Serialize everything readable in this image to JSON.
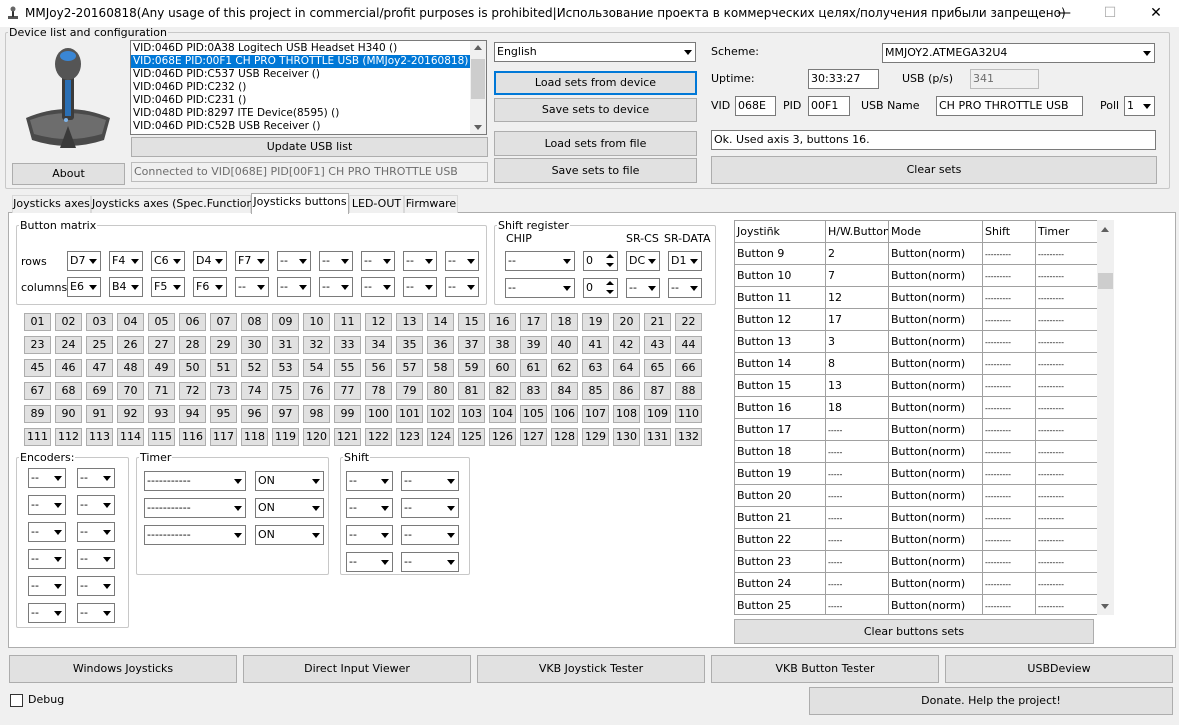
{
  "window": {
    "title": "MMJoy2-20160818(Any usage of this project in commercial/profit purposes is prohibited|Использование проекта в коммерческих целях/получения прибыли запрещено)",
    "min": "—",
    "max": "☐",
    "close": "✕"
  },
  "device_group": {
    "legend": "Device list and configuration",
    "about": "About",
    "update": "Update USB list",
    "status": "Connected to VID[068E] PID[00F1] CH PRO THROTTLE USB",
    "devices": [
      "VID:046D PID:0A38 Logitech USB Headset H340 ()",
      "VID:068E PID:00F1 CH PRO THROTTLE USB (MMJoy2-20160818)",
      "VID:046D PID:C537 USB Receiver ()",
      "VID:046D PID:C232  ()",
      "VID:046D PID:C231  ()",
      "VID:048D PID:8297 ITE Device(8595) ()",
      "VID:046D PID:C52B USB Receiver ()"
    ]
  },
  "language": "English",
  "sets": {
    "load_device": "Load sets from device",
    "save_device": "Save sets to device",
    "load_file": "Load sets from file",
    "save_file": "Save sets to file"
  },
  "config": {
    "scheme_label": "Scheme:",
    "scheme": "MMJOY2.ATMEGA32U4",
    "uptime_label": "Uptime:",
    "uptime": "30:33:27",
    "usb_label": "USB (p/s)",
    "usb": "341",
    "vid_label": "VID",
    "vid": "068E",
    "pid_label": "PID",
    "pid": "00F1",
    "name_label": "USB Name",
    "name": "CH PRO THROTTLE USB",
    "poll_label": "Poll",
    "poll": "1",
    "message": "Ok. Used axis  3, buttons 16.",
    "clear_sets": "Clear sets"
  },
  "tabs": [
    "Joysticks axes",
    "Joysticks axes (Spec.Functions)",
    "Joysticks buttons",
    "LED-OUT",
    "Firmware"
  ],
  "matrix": {
    "legend": "Button matrix",
    "rows_label": "rows",
    "cols_label": "columns",
    "rows": [
      "D7",
      "F4",
      "C6",
      "D4",
      "F7",
      "--",
      "--",
      "--",
      "--",
      "--"
    ],
    "cols": [
      "E6",
      "B4",
      "F5",
      "F6",
      "--",
      "--",
      "--",
      "--",
      "--",
      "--"
    ]
  },
  "shift_reg": {
    "legend": "Shift register",
    "chip": "CHIP",
    "srcs": "SR-CS",
    "srdata": "SR-DATA",
    "row1": [
      "--",
      "0",
      "DC",
      "D1"
    ],
    "row2": [
      "--",
      "0",
      "--",
      "--"
    ]
  },
  "buttons": [
    "01",
    "02",
    "03",
    "04",
    "05",
    "06",
    "07",
    "08",
    "09",
    "10",
    "11",
    "12",
    "13",
    "14",
    "15",
    "16",
    "17",
    "18",
    "19",
    "20",
    "21",
    "22",
    "23",
    "24",
    "25",
    "26",
    "27",
    "28",
    "29",
    "30",
    "31",
    "32",
    "33",
    "34",
    "35",
    "36",
    "37",
    "38",
    "39",
    "40",
    "41",
    "42",
    "43",
    "44",
    "45",
    "46",
    "47",
    "48",
    "49",
    "50",
    "51",
    "52",
    "53",
    "54",
    "55",
    "56",
    "57",
    "58",
    "59",
    "60",
    "61",
    "62",
    "63",
    "64",
    "65",
    "66",
    "67",
    "68",
    "69",
    "70",
    "71",
    "72",
    "73",
    "74",
    "75",
    "76",
    "77",
    "78",
    "79",
    "80",
    "81",
    "82",
    "83",
    "84",
    "85",
    "86",
    "87",
    "88",
    "89",
    "90",
    "91",
    "92",
    "93",
    "94",
    "95",
    "96",
    "97",
    "98",
    "99",
    "100",
    "101",
    "102",
    "103",
    "104",
    "105",
    "106",
    "107",
    "108",
    "109",
    "110",
    "111",
    "112",
    "113",
    "114",
    "115",
    "116",
    "117",
    "118",
    "119",
    "120",
    "121",
    "122",
    "123",
    "124",
    "125",
    "126",
    "127",
    "128",
    "129",
    "130",
    "131",
    "132"
  ],
  "encoders": {
    "legend": "Encoders:",
    "val": "--"
  },
  "timer": {
    "legend": "Timer",
    "sel": "-----------",
    "on": "ON"
  },
  "shift": {
    "legend": "Shift",
    "val": "--"
  },
  "grid": {
    "headers": [
      "Joystiñk",
      "H/W.Button",
      "Mode",
      "Shift",
      "Timer"
    ],
    "rows": [
      [
        "Button 9",
        "2",
        "Button(norm)",
        "---------",
        "---------"
      ],
      [
        "Button 10",
        "7",
        "Button(norm)",
        "---------",
        "---------"
      ],
      [
        "Button 11",
        "12",
        "Button(norm)",
        "---------",
        "---------"
      ],
      [
        "Button 12",
        "17",
        "Button(norm)",
        "---------",
        "---------"
      ],
      [
        "Button 13",
        "3",
        "Button(norm)",
        "---------",
        "---------"
      ],
      [
        "Button 14",
        "8",
        "Button(norm)",
        "---------",
        "---------"
      ],
      [
        "Button 15",
        "13",
        "Button(norm)",
        "---------",
        "---------"
      ],
      [
        "Button 16",
        "18",
        "Button(norm)",
        "---------",
        "---------"
      ],
      [
        "Button 17",
        "-----",
        "Button(norm)",
        "---------",
        "---------"
      ],
      [
        "Button 18",
        "-----",
        "Button(norm)",
        "---------",
        "---------"
      ],
      [
        "Button 19",
        "-----",
        "Button(norm)",
        "---------",
        "---------"
      ],
      [
        "Button 20",
        "-----",
        "Button(norm)",
        "---------",
        "---------"
      ],
      [
        "Button 21",
        "-----",
        "Button(norm)",
        "---------",
        "---------"
      ],
      [
        "Button 22",
        "-----",
        "Button(norm)",
        "---------",
        "---------"
      ],
      [
        "Button 23",
        "-----",
        "Button(norm)",
        "---------",
        "---------"
      ],
      [
        "Button 24",
        "-----",
        "Button(norm)",
        "---------",
        "---------"
      ],
      [
        "Button 25",
        "-----",
        "Button(norm)",
        "---------",
        "---------"
      ]
    ],
    "clear": "Clear buttons sets"
  },
  "bottom": [
    "Windows Joysticks",
    "Direct Input Viewer",
    "VKB Joystick Tester",
    "VKB Button Tester",
    "USBDeview"
  ],
  "debug": "Debug",
  "donate": "Donate. Help the project!"
}
